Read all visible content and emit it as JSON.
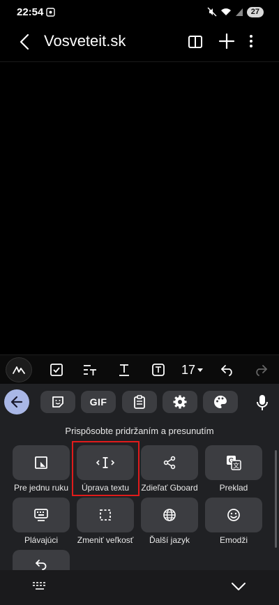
{
  "status_bar": {
    "time": "22:54",
    "battery": "27",
    "icons": [
      "screen-recorder-icon",
      "mute-icon",
      "wifi-icon",
      "signal-icon",
      "battery-icon"
    ]
  },
  "app_bar": {
    "title": "Vosveteit.sk",
    "icons": [
      "back-arrow-icon",
      "book-icon",
      "plus-icon",
      "more-vert-icon"
    ]
  },
  "format_toolbar": {
    "font_size": "17",
    "icons": [
      "pen-icon",
      "checkbox-icon",
      "text-style-icon",
      "text-underline-icon",
      "text-box-icon",
      "undo-icon",
      "redo-icon"
    ]
  },
  "keyboard": {
    "top_row": {
      "icons": [
        "back-arrow-icon",
        "sticker-icon",
        "gif-icon",
        "clipboard-icon",
        "settings-icon",
        "palette-icon",
        "mic-icon"
      ],
      "gif_label": "GIF"
    },
    "hint": "Prispôsobte pridržaním a presunutím",
    "tiles": [
      {
        "label": "Pre jednu ruku",
        "icon": "one-hand-icon"
      },
      {
        "label": "Úprava textu",
        "icon": "text-cursor-icon"
      },
      {
        "label": "Zdieľať Gboard",
        "icon": "share-icon"
      },
      {
        "label": "Preklad",
        "icon": "translate-icon"
      },
      {
        "label": "Plávajúci",
        "icon": "floating-keyboard-icon"
      },
      {
        "label": "Zmeniť veľkosť",
        "icon": "resize-icon"
      },
      {
        "label": "Ďalší jazyk",
        "icon": "globe-icon"
      },
      {
        "label": "Emodži",
        "icon": "emoji-icon"
      },
      {
        "label": "",
        "icon": "undo-icon"
      }
    ],
    "bottom": {
      "icons": [
        "keyboard-switch-icon",
        "chevron-down-icon"
      ]
    }
  },
  "colors": {
    "background": "#000000",
    "keyboard_bg": "#202124",
    "tile_bg": "#3c3d41",
    "accent_back": "#a9b7e6",
    "highlight": "#e01b1b"
  }
}
